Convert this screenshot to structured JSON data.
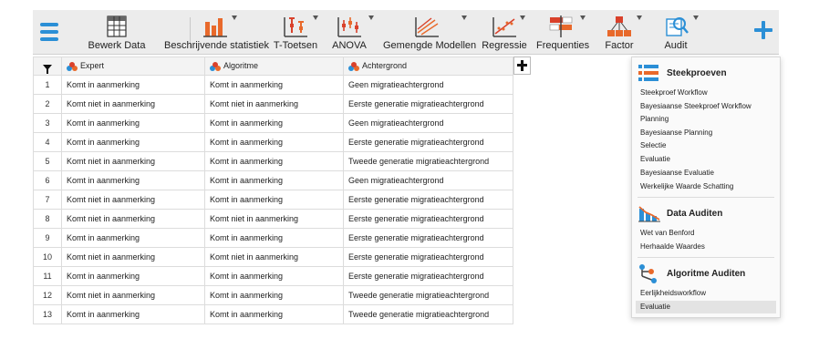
{
  "toolbar": {
    "items": [
      {
        "label": "Bewerk Data",
        "icon": "spreadsheet-icon"
      },
      {
        "label": "Beschrijvende statistiek",
        "icon": "bar-chart-icon"
      },
      {
        "label": "T-Toetsen",
        "icon": "t-test-icon"
      },
      {
        "label": "ANOVA",
        "icon": "anova-icon"
      },
      {
        "label": "Gemengde Modellen",
        "icon": "mixed-models-icon"
      },
      {
        "label": "Regressie",
        "icon": "regression-icon"
      },
      {
        "label": "Frequenties",
        "icon": "frequencies-icon"
      },
      {
        "label": "Factor",
        "icon": "factor-icon"
      },
      {
        "label": "Audit",
        "icon": "audit-icon"
      }
    ]
  },
  "colors": {
    "accent": "#2b8fd6",
    "orange": "#e8692b",
    "red": "#d9412b"
  },
  "table": {
    "columns": [
      "Expert",
      "Algoritme",
      "Achtergrond"
    ],
    "rows": [
      [
        "1",
        "Komt in aanmerking",
        "Komt in aanmerking",
        "Geen migratieachtergrond"
      ],
      [
        "2",
        "Komt niet in aanmerking",
        "Komt niet in aanmerking",
        "Eerste generatie migratieachtergrond"
      ],
      [
        "3",
        "Komt in aanmerking",
        "Komt in aanmerking",
        "Geen migratieachtergrond"
      ],
      [
        "4",
        "Komt in aanmerking",
        "Komt in aanmerking",
        "Eerste generatie migratieachtergrond"
      ],
      [
        "5",
        "Komt niet in aanmerking",
        "Komt in aanmerking",
        "Tweede generatie migratieachtergrond"
      ],
      [
        "6",
        "Komt in aanmerking",
        "Komt in aanmerking",
        "Geen migratieachtergrond"
      ],
      [
        "7",
        "Komt niet in aanmerking",
        "Komt in aanmerking",
        "Eerste generatie migratieachtergrond"
      ],
      [
        "8",
        "Komt niet in aanmerking",
        "Komt niet in aanmerking",
        "Eerste generatie migratieachtergrond"
      ],
      [
        "9",
        "Komt in aanmerking",
        "Komt in aanmerking",
        "Eerste generatie migratieachtergrond"
      ],
      [
        "10",
        "Komt niet in aanmerking",
        "Komt niet in aanmerking",
        "Eerste generatie migratieachtergrond"
      ],
      [
        "11",
        "Komt in aanmerking",
        "Komt in aanmerking",
        "Eerste generatie migratieachtergrond"
      ],
      [
        "12",
        "Komt niet in aanmerking",
        "Komt in aanmerking",
        "Tweede generatie migratieachtergrond"
      ],
      [
        "13",
        "Komt in aanmerking",
        "Komt in aanmerking",
        "Tweede generatie migratieachtergrond"
      ]
    ]
  },
  "menu": {
    "sections": [
      {
        "title": "Steekproeven",
        "icon": "list-icon",
        "items": [
          "Steekproef Workflow",
          "Bayesiaanse Steekproef Workflow",
          "Planning",
          "Bayesiaanse Planning",
          "Selectie",
          "Evaluatie",
          "Bayesiaanse Evaluatie",
          "Werkelijke Waarde Schatting"
        ]
      },
      {
        "title": "Data Auditen",
        "icon": "data-audit-chart-icon",
        "items": [
          "Wet van Benford",
          "Herhaalde Waardes"
        ]
      },
      {
        "title": "Algoritme Auditen",
        "icon": "algorithm-tree-icon",
        "items": [
          "Eerlijkheidsworkflow",
          "Evaluatie"
        ]
      }
    ],
    "selected_item": "Evaluatie"
  }
}
